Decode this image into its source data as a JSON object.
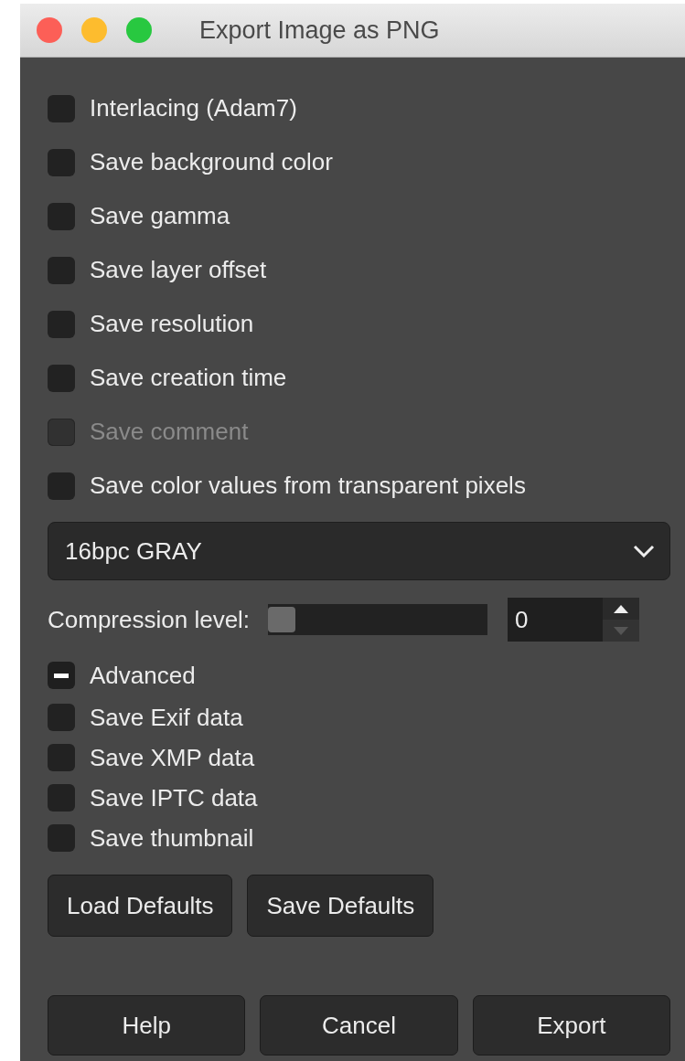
{
  "window": {
    "title": "Export Image as PNG"
  },
  "options": [
    {
      "label": "Interlacing (Adam7)",
      "checked": false,
      "disabled": false
    },
    {
      "label": "Save background color",
      "checked": false,
      "disabled": false
    },
    {
      "label": "Save gamma",
      "checked": false,
      "disabled": false
    },
    {
      "label": "Save layer offset",
      "checked": false,
      "disabled": false
    },
    {
      "label": "Save resolution",
      "checked": false,
      "disabled": false
    },
    {
      "label": "Save creation time",
      "checked": false,
      "disabled": false
    },
    {
      "label": "Save comment",
      "checked": false,
      "disabled": true
    },
    {
      "label": "Save color values from transparent pixels",
      "checked": false,
      "disabled": false
    }
  ],
  "format": {
    "value": "16bpc GRAY"
  },
  "compression": {
    "label": "Compression level:",
    "level": 0,
    "value": "0"
  },
  "advanced": {
    "label": "Advanced",
    "expanded": true,
    "options": [
      {
        "label": "Save Exif data",
        "checked": false
      },
      {
        "label": "Save XMP data",
        "checked": false
      },
      {
        "label": "Save IPTC data",
        "checked": false
      },
      {
        "label": "Save thumbnail",
        "checked": false
      }
    ]
  },
  "defaults_buttons": [
    "Load Defaults",
    "Save Defaults"
  ],
  "buttons": [
    "Help",
    "Cancel",
    "Export"
  ]
}
